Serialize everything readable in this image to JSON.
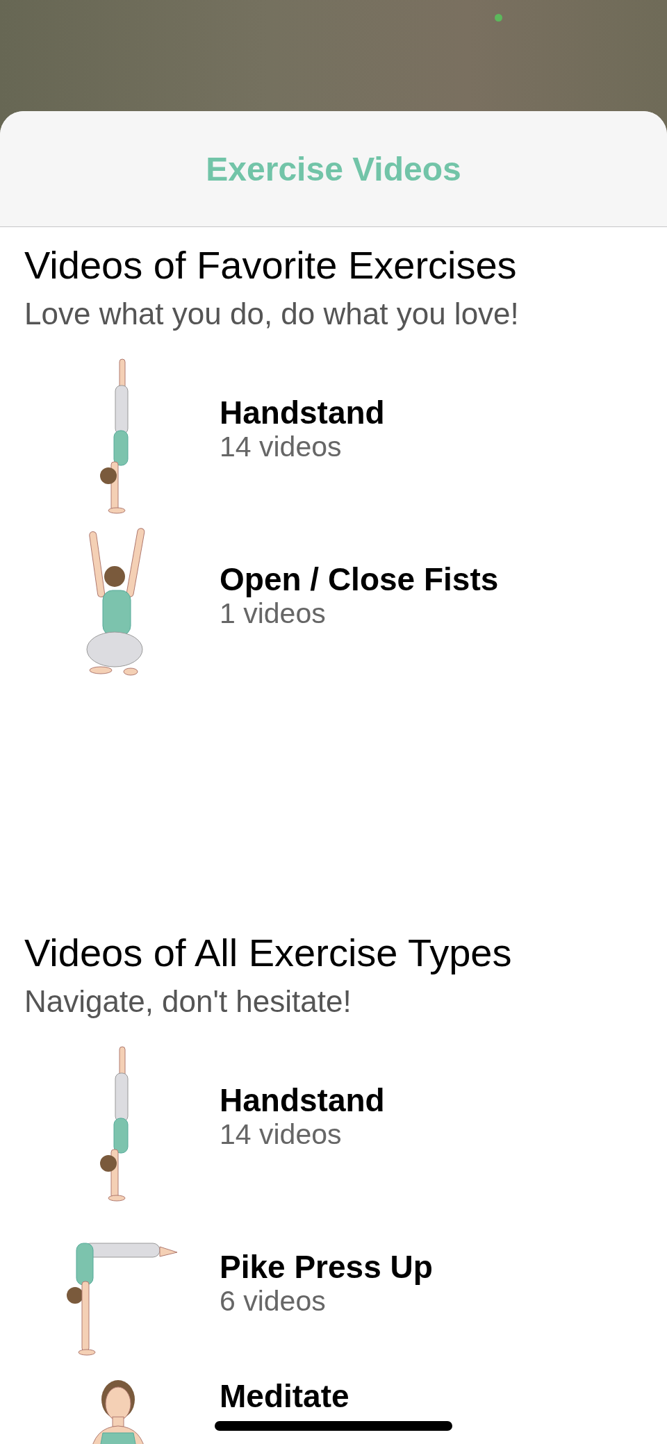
{
  "header": {
    "title": "Exercise Videos"
  },
  "sections": [
    {
      "title": "Videos of Favorite Exercises",
      "subtitle": "Love what you do, do what you love!",
      "items": [
        {
          "kind": "handstand",
          "name": "Handstand",
          "count": "14 videos"
        },
        {
          "kind": "squat",
          "name": "Open / Close Fists",
          "count": "1 videos"
        }
      ]
    },
    {
      "title": "Videos of All Exercise Types",
      "subtitle": "Navigate, don't hesitate!",
      "items": [
        {
          "kind": "handstand",
          "name": "Handstand",
          "count": "14 videos"
        },
        {
          "kind": "pike",
          "name": "Pike Press Up",
          "count": "6 videos"
        },
        {
          "kind": "seated",
          "name": "Meditate"
        }
      ]
    }
  ]
}
